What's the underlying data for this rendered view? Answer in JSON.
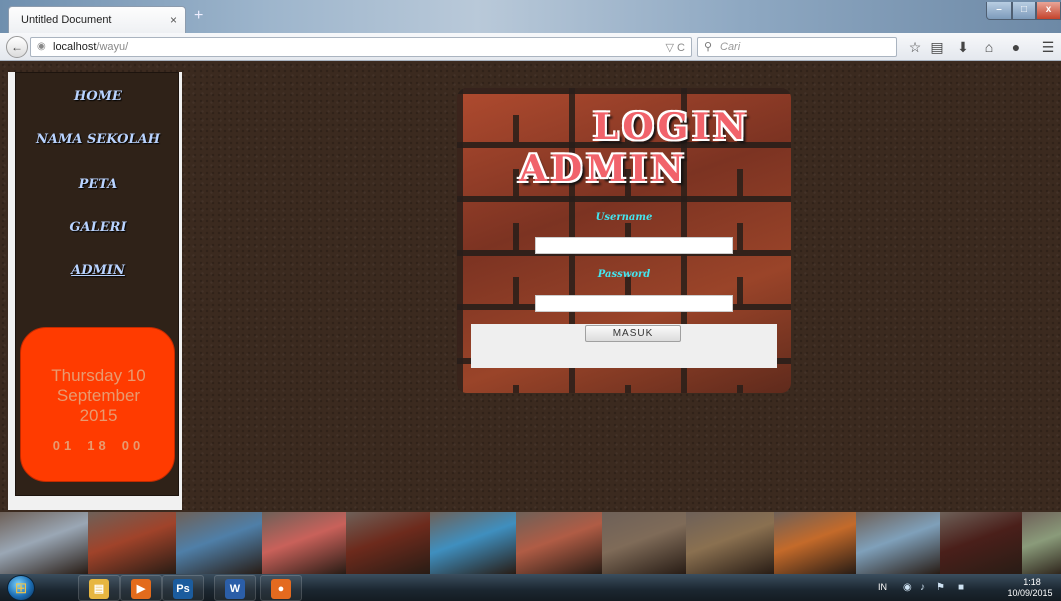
{
  "browser": {
    "tab_title": "Untitled Document",
    "tab_close": "×",
    "new_tab": "+",
    "window_controls": {
      "minimize": "–",
      "maximize": "□",
      "close": "x"
    },
    "back": "←",
    "url_host": "localhost",
    "url_path": "/wayu/",
    "url_right": "▽ C",
    "search_placeholder": "Cari",
    "toolbar_icons": [
      "star-icon",
      "clipboard-icon",
      "download-icon",
      "home-icon",
      "chat-icon",
      "menu-icon"
    ]
  },
  "sidebar": {
    "items": [
      {
        "label": "HOME"
      },
      {
        "label": "NAMA SEKOLAH"
      },
      {
        "label": "PETA"
      },
      {
        "label": "GALERI"
      },
      {
        "label": "ADMIN",
        "active": true
      }
    ],
    "clock": {
      "date_line1": "Thursday 10",
      "date_line2": "September",
      "date_line3": "2015",
      "hours": "01",
      "minutes": "18",
      "seconds": "00"
    }
  },
  "login": {
    "title_line1": "LOGIN",
    "title_line2": "ADMIN",
    "username_label": "Username",
    "username_value": "",
    "password_label": "Password",
    "password_value": "",
    "submit_label": "MASUK"
  },
  "photostrip": {
    "photos": [
      {
        "name": "church-photo",
        "color": "#9aa7b5"
      },
      {
        "name": "food-photo",
        "color": "#a0432a"
      },
      {
        "name": "school-group-photo",
        "color": "#4f7fa8"
      },
      {
        "name": "red-roof-photo",
        "color": "#c9615a"
      },
      {
        "name": "blur-photo",
        "color": "#6d2a1c"
      },
      {
        "name": "school-building-photo",
        "color": "#3f8fbf"
      },
      {
        "name": "school-yard-photo",
        "color": "#b05c45"
      },
      {
        "name": "crowd-photo",
        "color": "#7f6b58"
      },
      {
        "name": "assembly-photo",
        "color": "#8a7050"
      },
      {
        "name": "orange-building-photo",
        "color": "#c46a2a"
      },
      {
        "name": "school-gate-photo",
        "color": "#7fa0ba"
      },
      {
        "name": "silhouette-photo",
        "color": "#4a1f1a"
      },
      {
        "name": "campus-photo",
        "color": "#8a9b7a"
      }
    ]
  },
  "taskbar": {
    "apps": [
      {
        "name": "explorer-taskbar-button",
        "glyph": "▤",
        "color": "#e7b640"
      },
      {
        "name": "media-player-taskbar-button",
        "glyph": "▶",
        "color": "#e36b1c"
      },
      {
        "name": "photoshop-taskbar-button",
        "glyph": "Ps",
        "color": "#1b5c9e"
      },
      {
        "name": "word-taskbar-button",
        "glyph": "W",
        "color": "#2b5ea8"
      },
      {
        "name": "firefox-taskbar-button",
        "glyph": "●",
        "color": "#e46a1f"
      }
    ],
    "language": "IN",
    "time": "1:18",
    "date": "10/09/2015"
  }
}
